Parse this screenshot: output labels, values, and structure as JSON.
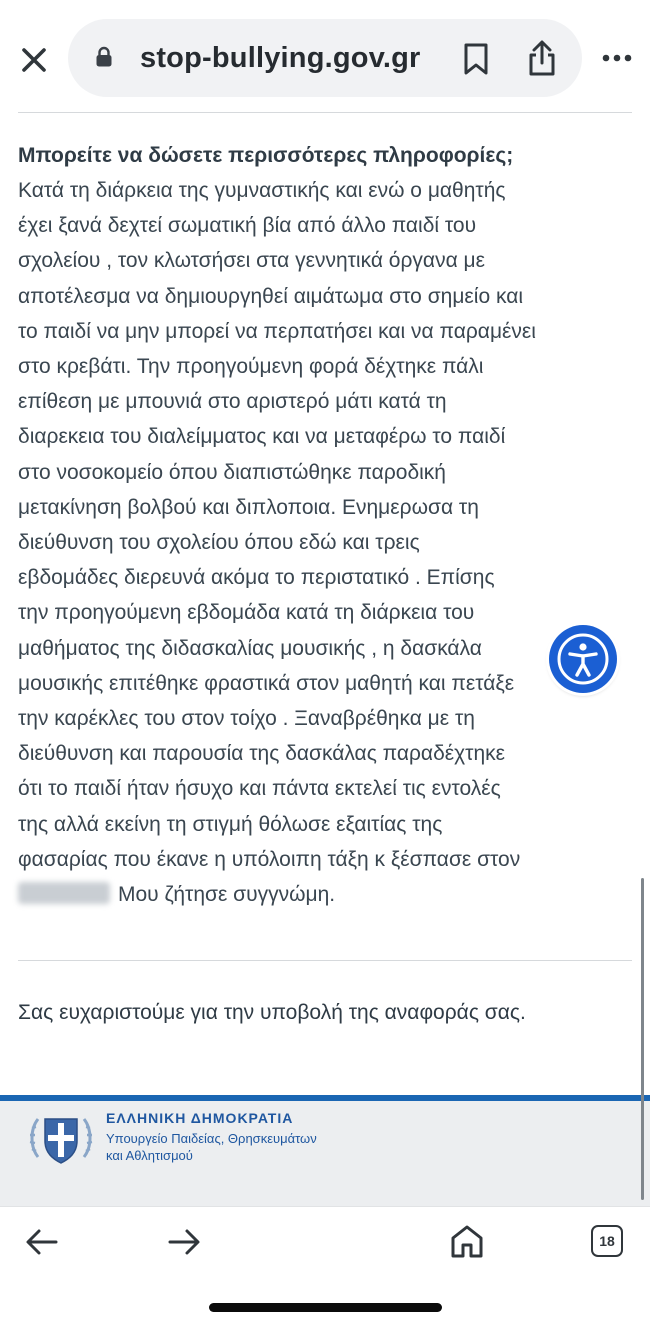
{
  "browser": {
    "url": "stop-bullying.gov.gr",
    "icons": {
      "close": "close-icon",
      "lock": "lock-icon",
      "bookmark": "bookmark-icon",
      "share": "share-icon",
      "more": "more-icon"
    }
  },
  "report": {
    "question": "Μπορείτε να δώσετε περισσότερες πληροφορίες;",
    "lines": [
      "Κατά τη διάρκεια της γυμναστικής και ενώ ο μαθητής",
      "έχει ξανά δεχτεί σωματική βία από άλλο παιδί του",
      "σχολείου , τον κλωτσήσει στα γεννητικά όργανα με",
      "αποτέλεσμα να δημιουργηθεί αιμάτωμα στο σημείο και",
      "το παιδί να μην μπορεί να περπατήσει και να παραμένει",
      "στο κρεβάτι. Την προηγούμενη φορά δέχτηκε πάλι",
      "επίθεση με μπουνιά στο αριστερό μάτι κατά τη",
      "διαρεκεια του διαλείμματος και να μεταφέρω το παιδί",
      "στο νοσοκομείο όπου διαπιστώθηκε παροδική",
      "μετακίνηση βολβού και διπλοποια. Ενημερωσα τη",
      "διεύθυνση του σχολείου όπου εδώ και τρεις",
      "εβδομάδες διερευνά ακόμα το περιστατικό . Επίσης",
      "την προηγούμενη εβδομάδα κατά τη διάρκεια του",
      "μαθήματος της διδασκαλίας μουσικής , η δασκάλα",
      "μουσικής επιτέθηκε φραστικά στον μαθητή και πετάξε",
      "την καρέκλες του στον τοίχο . Ξαναβρέθηκα με τη",
      "διεύθυνση και παρουσία της δασκάλας παραδέχτηκε",
      "ότι το παιδί ήταν ήσυχο και πάντα εκτελεί τις εντολές",
      "της αλλά εκείνη τη στιγμή θόλωσε εξαιτίας της",
      "φασαρίας που έκανε η υπόλοιπη τάξη κ ξέσπασε στον"
    ],
    "last_line": "Μου ζήτησε συγγνώμη."
  },
  "thanks_message": "Σας ευχαριστούμε για την υποβολή της αναφοράς σας.",
  "accessibility_button": {
    "icon": "accessibility-icon",
    "color": "#1b5fd3"
  },
  "footer": {
    "title": "ΕΛΛΗΝΙΚΗ ΔΗΜΟΚΡΑΤΙΑ",
    "ministry_line1": "Υπουργείο Παιδείας, Θρησκευμάτων",
    "ministry_line2": "και Αθλητισμού",
    "emblem_icon": "greek-coat-of-arms-icon",
    "accent_color": "#1a66b3"
  },
  "toolbar": {
    "tab_count": "18",
    "icons": {
      "back": "back-arrow-icon",
      "forward": "forward-arrow-icon",
      "home": "home-icon",
      "tabs": "tabs-icon"
    }
  }
}
